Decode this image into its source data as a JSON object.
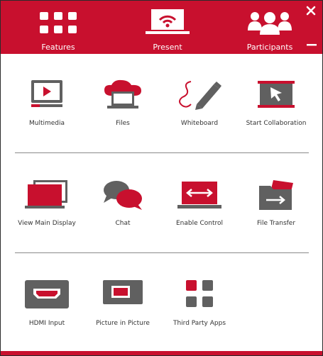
{
  "header": {
    "tabs": [
      {
        "label": "Features",
        "icon": "grid-icon"
      },
      {
        "label": "Present",
        "icon": "laptop-wifi-icon"
      },
      {
        "label": "Participants",
        "icon": "people-icon"
      }
    ],
    "close_glyph": "×"
  },
  "rows": [
    [
      {
        "label": "Multimedia",
        "icon": "video-screen-icon"
      },
      {
        "label": "Files",
        "icon": "cloud-laptop-icon"
      },
      {
        "label": "Whiteboard",
        "icon": "pen-icon"
      },
      {
        "label": "Start Collaboration",
        "icon": "cursor-board-icon"
      }
    ],
    [
      {
        "label": "View Main Display",
        "icon": "dual-display-icon"
      },
      {
        "label": "Chat",
        "icon": "chat-bubbles-icon"
      },
      {
        "label": "Enable Control",
        "icon": "laptop-arrows-icon"
      },
      {
        "label": "File Transfer",
        "icon": "folder-transfer-icon"
      }
    ],
    [
      {
        "label": "HDMI Input",
        "icon": "hdmi-icon"
      },
      {
        "label": "Picture in Picture",
        "icon": "pip-icon"
      },
      {
        "label": "Third Party Apps",
        "icon": "apps-grid-icon"
      }
    ]
  ],
  "colors": {
    "accent": "#c8102e",
    "icon_gray": "#606060",
    "text": "#333333"
  }
}
